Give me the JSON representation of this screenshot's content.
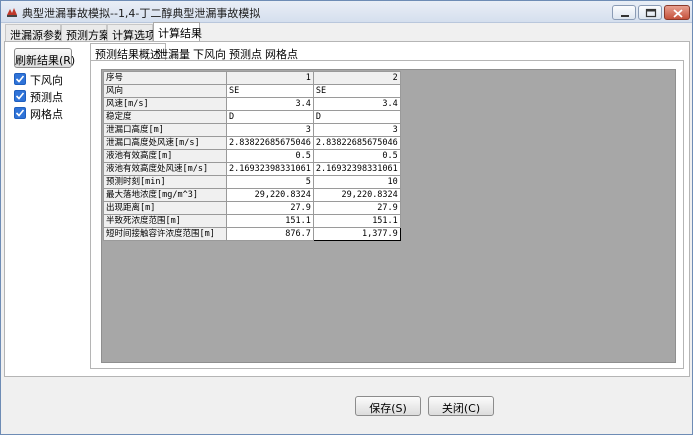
{
  "window": {
    "title": "典型泄漏事故模拟--1,4-丁二醇典型泄漏事故模拟"
  },
  "tabs": [
    "泄漏源参数",
    "预测方案",
    "计算选项",
    "计算结果"
  ],
  "active_tab": "计算结果",
  "left_panel": {
    "refresh_label": "刷新结果(R)",
    "checkboxes": [
      {
        "label": "下风向",
        "checked": true
      },
      {
        "label": "预测点",
        "checked": true
      },
      {
        "label": "网格点",
        "checked": true
      }
    ]
  },
  "subtabs": [
    "预测结果概述",
    "泄漏量",
    "下风向",
    "预测点",
    "网格点"
  ],
  "active_subtab": "预测结果概述",
  "table": {
    "header": [
      "序号",
      "1",
      "2"
    ],
    "rows": [
      {
        "label": "风向",
        "values": [
          "SE",
          "SE"
        ]
      },
      {
        "label": "风速[m/s]",
        "values": [
          "3.4",
          "3.4"
        ]
      },
      {
        "label": "稳定度",
        "values": [
          "D",
          "D"
        ]
      },
      {
        "label": "泄漏口高度[m]",
        "values": [
          "3",
          "3"
        ]
      },
      {
        "label": "泄漏口高度处风速[m/s]",
        "values": [
          "2.83822685675046",
          "2.83822685675046"
        ]
      },
      {
        "label": "液池有效高度[m]",
        "values": [
          "0.5",
          "0.5"
        ]
      },
      {
        "label": "液池有效高度处风速[m/s]",
        "values": [
          "2.16932398331061",
          "2.16932398331061"
        ]
      },
      {
        "label": "预测时刻[min]",
        "values": [
          "5",
          "10"
        ]
      },
      {
        "label": "最大落地浓度[mg/m^3]",
        "values": [
          "29,220.8324",
          "29,220.8324"
        ]
      },
      {
        "label": "出现距离[m]",
        "values": [
          "27.9",
          "27.9"
        ]
      },
      {
        "label": "半致死浓度范围[m]",
        "values": [
          "151.1",
          "151.1"
        ]
      },
      {
        "label": "短时间接触容许浓度范围[m]",
        "values": [
          "876.7",
          "1,377.9"
        ]
      }
    ]
  },
  "footer": {
    "save_label": "保存(S)",
    "close_label": "关闭(C)"
  }
}
